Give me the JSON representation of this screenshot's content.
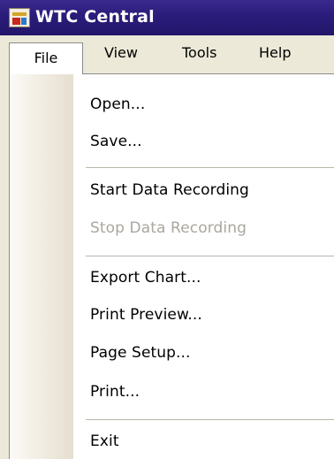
{
  "window": {
    "title": "WTC Central",
    "icon": "app-icon"
  },
  "menubar": {
    "items": [
      {
        "label": "File",
        "active": true
      },
      {
        "label": "View"
      },
      {
        "label": "Tools"
      },
      {
        "label": "Help"
      }
    ]
  },
  "file_menu": {
    "items": [
      {
        "label": "Open...",
        "enabled": true
      },
      {
        "label": "Save...",
        "enabled": true
      },
      {
        "separator": true
      },
      {
        "label": "Start Data Recording",
        "enabled": true
      },
      {
        "label": "Stop Data Recording",
        "enabled": false
      },
      {
        "separator": true
      },
      {
        "label": "Export Chart...",
        "enabled": true
      },
      {
        "label": "Print Preview...",
        "enabled": true
      },
      {
        "label": "Page Setup...",
        "enabled": true
      },
      {
        "label": "Print...",
        "enabled": true
      },
      {
        "separator": true
      },
      {
        "label": "Exit",
        "enabled": true
      }
    ]
  },
  "colors": {
    "titlebar": "#2a1c7a",
    "menubar": "#ece9d8",
    "menu_bg": "#ffffff",
    "disabled_text": "#a9a79e"
  }
}
